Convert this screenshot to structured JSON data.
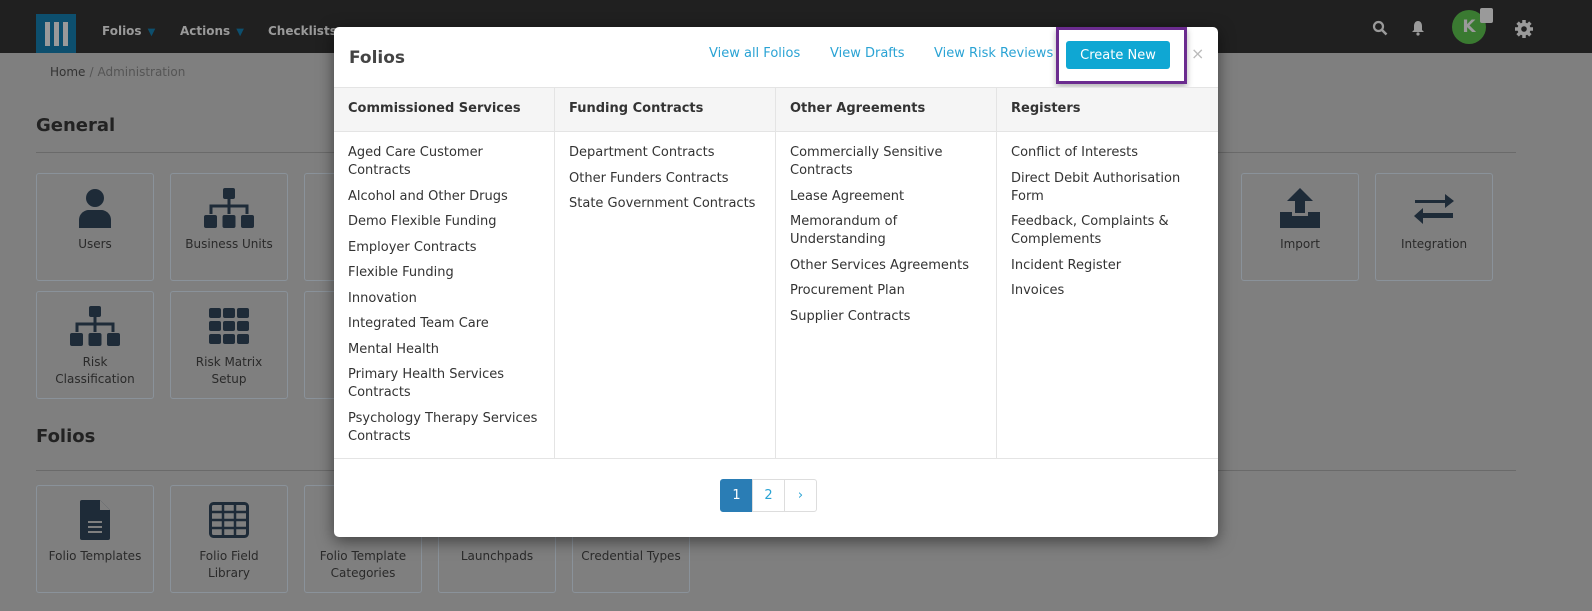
{
  "nav": {
    "items": [
      {
        "label": "Folios",
        "dropdown": true
      },
      {
        "label": "Actions",
        "dropdown": true
      },
      {
        "label": "Checklists",
        "dropdown": false
      }
    ],
    "avatar_initial": "K",
    "avatar_color": "#3a7a31"
  },
  "breadcrumb": {
    "home": "Home",
    "separator": "/",
    "current": "Administration"
  },
  "sections": {
    "general": "General",
    "folios": "Folios"
  },
  "tiles": {
    "users": "Users",
    "business_units": "Business Units",
    "import": "Import",
    "integration": "Integration",
    "risk_classification": "Risk Classification",
    "risk_matrix": "Risk Matrix Setup",
    "folio_templates": "Folio Templates",
    "folio_field_library": "Folio Field Library",
    "folio_template_categories": "Folio Template Categories",
    "launchpads": "Launchpads",
    "credential_types": "Credential Types"
  },
  "modal": {
    "title": "Folios",
    "links": [
      "View all Folios",
      "View Drafts",
      "View Risk Reviews"
    ],
    "create_label": "Create New",
    "close": "×",
    "columns": [
      {
        "header": "Commissioned Services",
        "items": [
          "Aged Care Customer Contracts",
          "Alcohol and Other Drugs",
          "Demo Flexible Funding",
          "Employer Contracts",
          "Flexible Funding",
          "Innovation",
          "Integrated Team Care",
          "Mental Health",
          "Primary Health Services Contracts",
          "Psychology Therapy Services Contracts"
        ]
      },
      {
        "header": "Funding Contracts",
        "items": [
          "Department Contracts",
          "Other Funders Contracts",
          "State Government Contracts"
        ]
      },
      {
        "header": "Other Agreements",
        "items": [
          "Commercially Sensitive Contracts",
          "Lease Agreement",
          "Memorandum of Understanding",
          "Other Services Agreements",
          "Procurement Plan",
          "Supplier Contracts"
        ]
      },
      {
        "header": "Registers",
        "items": [
          "Conflict of Interests",
          "Direct Debit Authorisation Form",
          "Feedback, Complaints & Complements",
          "Incident Register",
          "Invoices"
        ]
      }
    ],
    "pagination": {
      "pages": [
        "1",
        "2"
      ],
      "current": "1",
      "next": "›"
    }
  },
  "colors": {
    "accent": "#0fa7d3",
    "highlight": "#6b2c8f",
    "active_page": "#2a7db5"
  }
}
